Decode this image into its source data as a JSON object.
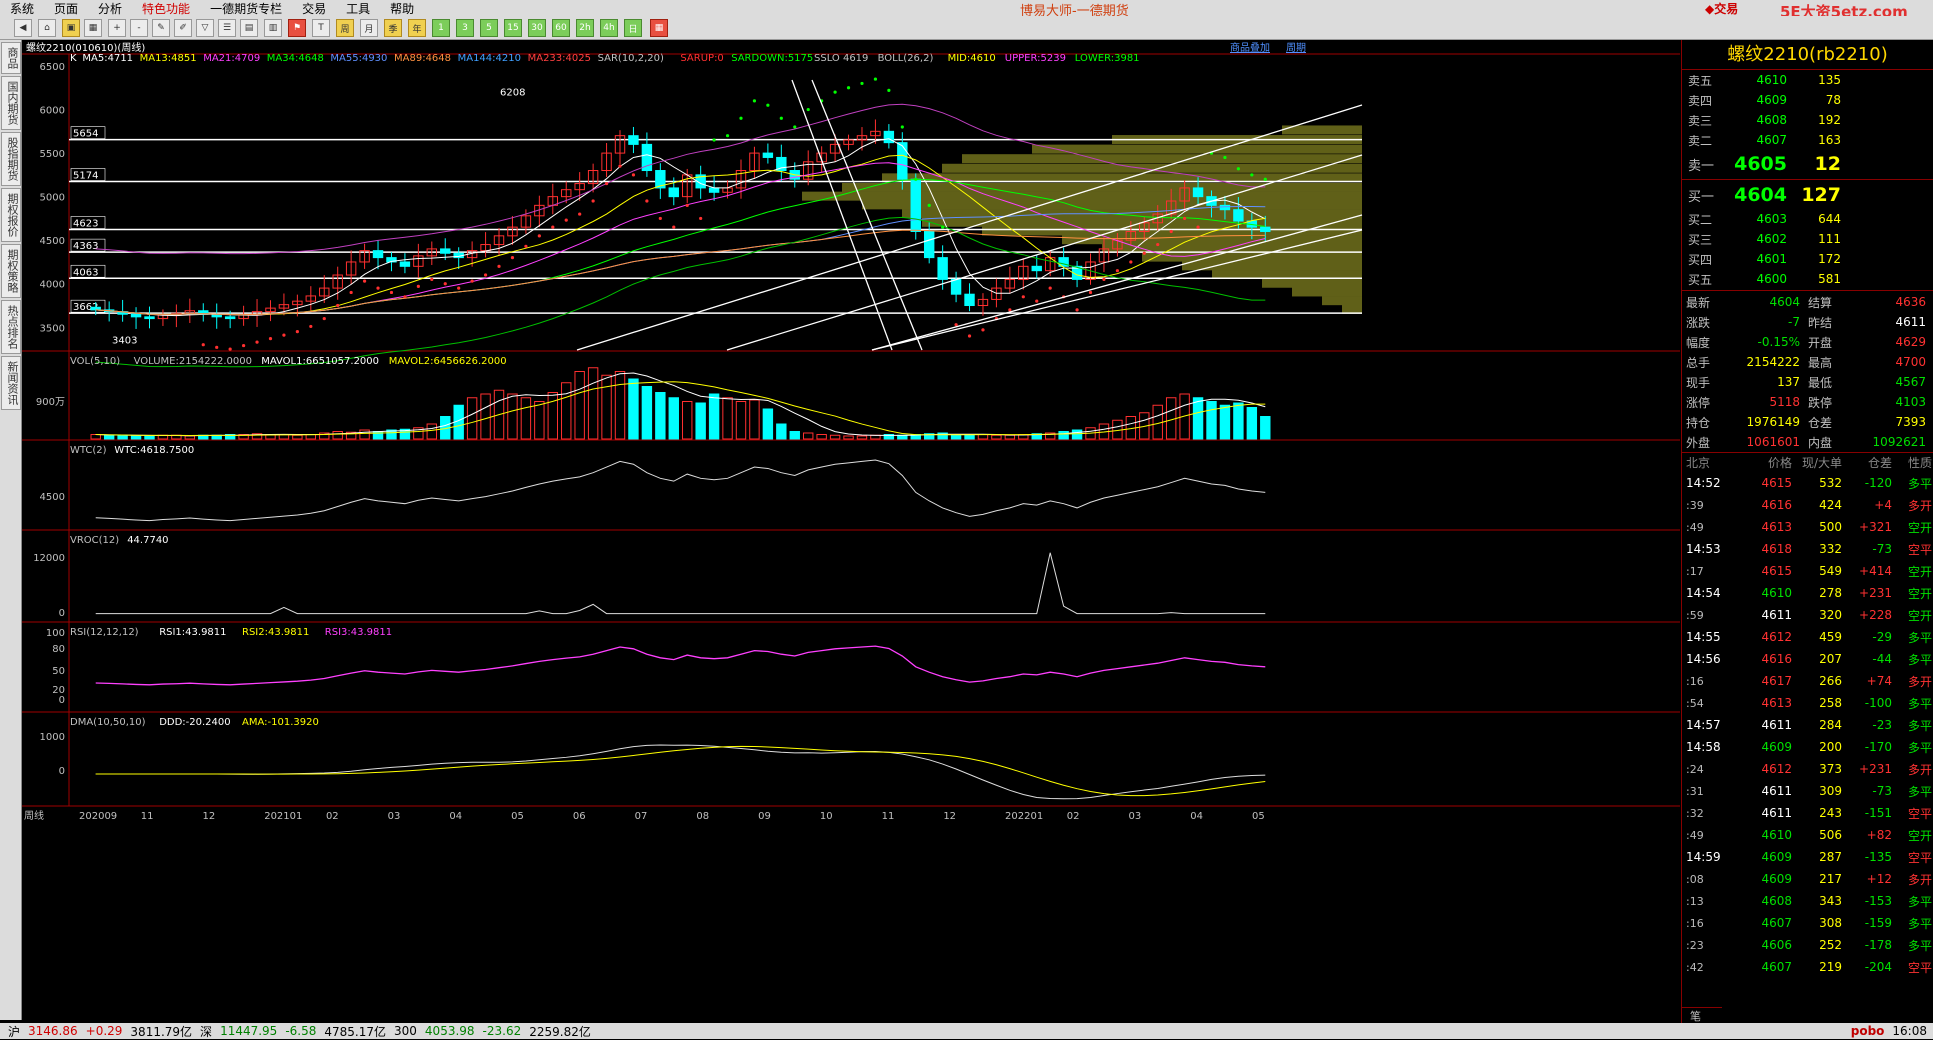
{
  "menu": [
    "系统",
    "页面",
    "分析",
    "特色功能",
    "一德期货专栏",
    "交易",
    "工具",
    "帮助"
  ],
  "app_title": "博易大师-一德期货",
  "trade_label": "交易",
  "site_label": "5E大资5etz.com",
  "side_tabs": [
    "商品",
    "国内期货",
    "股指期货",
    "期权报价",
    "期权策略",
    "热点排名",
    "新闻资讯"
  ],
  "chart_header": "螺纹2210(010610)(周线)",
  "chart_links": [
    "商品叠加",
    "周期"
  ],
  "ma_line": [
    {
      "text": "K",
      "color": "#ffffff"
    },
    {
      "text": "MA5:4711",
      "color": "#ffffff"
    },
    {
      "text": "MA13:4851",
      "color": "#ffff00"
    },
    {
      "text": "MA21:4709",
      "color": "#ff40ff"
    },
    {
      "text": "MA34:4648",
      "color": "#00ff00"
    },
    {
      "text": "MA55:4930",
      "color": "#6090ff"
    },
    {
      "text": "MA89:4648",
      "color": "#ff9040"
    },
    {
      "text": "MA144:4210",
      "color": "#40a0ff"
    },
    {
      "text": "MA233:4025",
      "color": "#ff4040"
    },
    {
      "text": "SAR(10,2,20)",
      "color": "#c0c0c0"
    },
    {
      "text": "SARUP:0",
      "color": "#ff3030"
    },
    {
      "text": "SARDOWN:5175",
      "color": "#00ff00"
    },
    {
      "text": "SSLO 4619",
      "color": "#c0c0c0"
    },
    {
      "text": "BOLL(26,2)",
      "color": "#c0c0c0"
    },
    {
      "text": "MID:4610",
      "color": "#ffff00"
    },
    {
      "text": "UPPER:5239",
      "color": "#ff40ff"
    },
    {
      "text": "LOWER:3981",
      "color": "#00ff00"
    }
  ],
  "price_axis": [
    "6500",
    "6000",
    "5500",
    "5000",
    "4500",
    "4000",
    "3500"
  ],
  "level_lines": [
    "5654",
    "5174",
    "4623",
    "4363",
    "4063",
    "3662"
  ],
  "high_mark": "6208",
  "low_mark": "3403",
  "vol_header": [
    {
      "text": "VOL(5,10)",
      "color": "#c0c0c0"
    },
    {
      "text": "VOLUME:2154222.0000",
      "color": "#c0c0c0"
    },
    {
      "text": "MAVOL1:6651057.2000",
      "color": "#ffffff"
    },
    {
      "text": "MAVOL2:6456626.2000",
      "color": "#ffff00"
    }
  ],
  "vol_axis": [
    "900万"
  ],
  "wtc_header": [
    {
      "text": "WTC(2)",
      "color": "#c0c0c0"
    },
    {
      "text": "WTC:4618.7500",
      "color": "#ffffff"
    }
  ],
  "wtc_axis": [
    "4500"
  ],
  "vroc_header": [
    {
      "text": "VROC(12)",
      "color": "#c0c0c0"
    },
    {
      "text": "44.7740",
      "color": "#ffffff"
    }
  ],
  "vroc_axis": [
    "12000",
    "0"
  ],
  "rsi_header": [
    {
      "text": "RSI(12,12,12)",
      "color": "#c0c0c0"
    },
    {
      "text": "RSI1:43.9811",
      "color": "#ffffff"
    },
    {
      "text": "RSI2:43.9811",
      "color": "#ffff00"
    },
    {
      "text": "RSI3:43.9811",
      "color": "#ff40ff"
    }
  ],
  "rsi_axis": [
    "100",
    "80",
    "50",
    "20",
    "0"
  ],
  "dma_header": [
    {
      "text": "DMA(10,50,10)",
      "color": "#c0c0c0"
    },
    {
      "text": "DDD:-20.2400",
      "color": "#ffffff"
    },
    {
      "text": "AMA:-101.3920",
      "color": "#ffff00"
    }
  ],
  "dma_axis": [
    "1000",
    "0"
  ],
  "x_axis_title": "周线",
  "x_axis": [
    "202009",
    "11",
    "12",
    "202101",
    "02",
    "03",
    "04",
    "05",
    "06",
    "07",
    "08",
    "09",
    "10",
    "11",
    "12",
    "202201",
    "02",
    "03",
    "04",
    "05"
  ],
  "right": {
    "title": "螺纹2210(rb2210)",
    "asks": [
      {
        "label": "卖五",
        "price": "4610",
        "vol": "135"
      },
      {
        "label": "卖四",
        "price": "4609",
        "vol": "78"
      },
      {
        "label": "卖三",
        "price": "4608",
        "vol": "192"
      },
      {
        "label": "卖二",
        "price": "4607",
        "vol": "163"
      },
      {
        "label": "卖一",
        "price": "4605",
        "vol": "12"
      }
    ],
    "bids": [
      {
        "label": "买一",
        "price": "4604",
        "vol": "127"
      },
      {
        "label": "买二",
        "price": "4603",
        "vol": "644"
      },
      {
        "label": "买三",
        "price": "4602",
        "vol": "111"
      },
      {
        "label": "买四",
        "price": "4601",
        "vol": "172"
      },
      {
        "label": "买五",
        "price": "4600",
        "vol": "581"
      }
    ],
    "quote": [
      {
        "k1": "最新",
        "v1": "4604",
        "c1": "dn",
        "k2": "结算",
        "v2": "4636",
        "c2": "up"
      },
      {
        "k1": "涨跌",
        "v1": "-7",
        "c1": "dn",
        "k2": "昨结",
        "v2": "4611",
        "c2": "wh"
      },
      {
        "k1": "幅度",
        "v1": "-0.15%",
        "c1": "dn",
        "k2": "开盘",
        "v2": "4629",
        "c2": "up"
      },
      {
        "k1": "总手",
        "v1": "2154222",
        "c1": "yl",
        "k2": "最高",
        "v2": "4700",
        "c2": "up"
      },
      {
        "k1": "现手",
        "v1": "137",
        "c1": "yl",
        "k2": "最低",
        "v2": "4567",
        "c2": "dn"
      },
      {
        "k1": "涨停",
        "v1": "5118",
        "c1": "up",
        "k2": "跌停",
        "v2": "4103",
        "c2": "dn"
      },
      {
        "k1": "持仓",
        "v1": "1976149",
        "c1": "yl",
        "k2": "仓差",
        "v2": "7393",
        "c2": "yl"
      },
      {
        "k1": "外盘",
        "v1": "1061601",
        "c1": "up",
        "k2": "内盘",
        "v2": "1092621",
        "c2": "dn"
      }
    ],
    "tick_header": [
      "北京",
      "价格",
      "现/大单",
      "仓差",
      "性质"
    ],
    "ticks": [
      {
        "t": "14:52",
        "p": "4615",
        "pc": "up",
        "v": "532",
        "o": "-120",
        "oc": "dn",
        "ty": "多平",
        "tc": "dn"
      },
      {
        "t": ":39",
        "p": "4616",
        "pc": "up",
        "v": "424",
        "o": "+4",
        "oc": "up",
        "ty": "多开",
        "tc": "up"
      },
      {
        "t": ":49",
        "p": "4613",
        "pc": "up",
        "v": "500",
        "o": "+321",
        "oc": "up",
        "ty": "空开",
        "tc": "dn"
      },
      {
        "t": "14:53",
        "p": "4618",
        "pc": "up",
        "v": "332",
        "o": "-73",
        "oc": "dn",
        "ty": "空平",
        "tc": "up"
      },
      {
        "t": ":17",
        "p": "4615",
        "pc": "up",
        "v": "549",
        "o": "+414",
        "oc": "up",
        "ty": "空开",
        "tc": "dn"
      },
      {
        "t": "14:54",
        "p": "4610",
        "pc": "dn",
        "v": "278",
        "o": "+231",
        "oc": "up",
        "ty": "空开",
        "tc": "dn"
      },
      {
        "t": ":59",
        "p": "4611",
        "pc": "wh",
        "v": "320",
        "o": "+228",
        "oc": "up",
        "ty": "空开",
        "tc": "dn"
      },
      {
        "t": "14:55",
        "p": "4612",
        "pc": "up",
        "v": "459",
        "o": "-29",
        "oc": "dn",
        "ty": "多平",
        "tc": "dn"
      },
      {
        "t": "14:56",
        "p": "4616",
        "pc": "up",
        "v": "207",
        "o": "-44",
        "oc": "dn",
        "ty": "多平",
        "tc": "dn"
      },
      {
        "t": ":16",
        "p": "4617",
        "pc": "up",
        "v": "266",
        "o": "+74",
        "oc": "up",
        "ty": "多开",
        "tc": "up"
      },
      {
        "t": ":54",
        "p": "4613",
        "pc": "up",
        "v": "258",
        "o": "-100",
        "oc": "dn",
        "ty": "多平",
        "tc": "dn"
      },
      {
        "t": "14:57",
        "p": "4611",
        "pc": "wh",
        "v": "284",
        "o": "-23",
        "oc": "dn",
        "ty": "多平",
        "tc": "dn"
      },
      {
        "t": "14:58",
        "p": "4609",
        "pc": "dn",
        "v": "200",
        "o": "-170",
        "oc": "dn",
        "ty": "多平",
        "tc": "dn"
      },
      {
        "t": ":24",
        "p": "4612",
        "pc": "up",
        "v": "373",
        "o": "+231",
        "oc": "up",
        "ty": "多开",
        "tc": "up"
      },
      {
        "t": ":31",
        "p": "4611",
        "pc": "wh",
        "v": "309",
        "o": "-73",
        "oc": "dn",
        "ty": "多平",
        "tc": "dn"
      },
      {
        "t": ":32",
        "p": "4611",
        "pc": "wh",
        "v": "243",
        "o": "-151",
        "oc": "dn",
        "ty": "空平",
        "tc": "up"
      },
      {
        "t": ":49",
        "p": "4610",
        "pc": "dn",
        "v": "506",
        "o": "+82",
        "oc": "up",
        "ty": "空开",
        "tc": "dn"
      },
      {
        "t": "14:59",
        "p": "4609",
        "pc": "dn",
        "v": "287",
        "o": "-135",
        "oc": "dn",
        "ty": "空平",
        "tc": "up"
      },
      {
        "t": ":08",
        "p": "4609",
        "pc": "dn",
        "v": "217",
        "o": "+12",
        "oc": "up",
        "ty": "多开",
        "tc": "up"
      },
      {
        "t": ":13",
        "p": "4608",
        "pc": "dn",
        "v": "343",
        "o": "-153",
        "oc": "dn",
        "ty": "多平",
        "tc": "dn"
      },
      {
        "t": ":16",
        "p": "4607",
        "pc": "dn",
        "v": "308",
        "o": "-159",
        "oc": "dn",
        "ty": "多平",
        "tc": "dn"
      },
      {
        "t": ":23",
        "p": "4606",
        "pc": "dn",
        "v": "252",
        "o": "-178",
        "oc": "dn",
        "ty": "多平",
        "tc": "dn"
      },
      {
        "t": ":42",
        "p": "4607",
        "pc": "dn",
        "v": "219",
        "o": "-204",
        "oc": "dn",
        "ty": "空平",
        "tc": "up"
      }
    ],
    "tab": "笔"
  },
  "status": [
    {
      "text": "沪",
      "c": "#000"
    },
    {
      "text": "3146.86",
      "c": "#d00000"
    },
    {
      "text": "+0.29",
      "c": "#d00000"
    },
    {
      "text": "3811.79亿",
      "c": "#000"
    },
    {
      "text": "深",
      "c": "#000"
    },
    {
      "text": "11447.95",
      "c": "#008000"
    },
    {
      "text": "-6.58",
      "c": "#008000"
    },
    {
      "text": "4785.17亿",
      "c": "#000"
    },
    {
      "text": "300",
      "c": "#000"
    },
    {
      "text": "4053.98",
      "c": "#008000"
    },
    {
      "text": "-23.62",
      "c": "#008000"
    },
    {
      "text": "2259.82亿",
      "c": "#000"
    }
  ],
  "status_right": {
    "brand": "pobo",
    "time": "16:08"
  }
}
